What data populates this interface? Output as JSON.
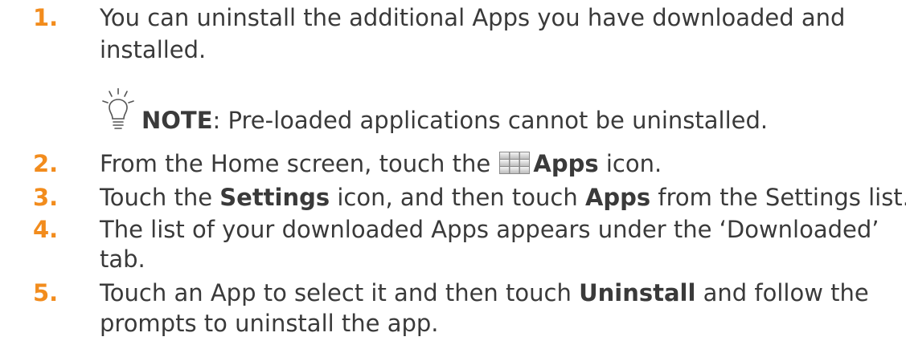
{
  "colors": {
    "number": "#f28c1d",
    "text": "#3a3a3a"
  },
  "steps": [
    {
      "number": "1.",
      "line1": "You can uninstall the additional Apps you have downloaded and",
      "line2": "installed."
    },
    {
      "number": "2.",
      "pre": "From the Home screen, touch the",
      "bold": "Apps",
      "post": "icon.",
      "icon": "apps-grid-icon"
    },
    {
      "number": "3.",
      "pre": "Touch the",
      "bold1": "Settings",
      "mid": "icon, and then touch",
      "bold2": "Apps",
      "post": "from the Settings list."
    },
    {
      "number": "4.",
      "line1": "The list of your downloaded Apps appears under the ‘Downloaded’",
      "line2": "tab."
    },
    {
      "number": "5.",
      "pre": "Touch an App to select it and then touch",
      "bold": "Uninstall",
      "post": "and follow the",
      "line2": "prompts to uninstall the app."
    }
  ],
  "note": {
    "icon": "lightbulb-icon",
    "label": "NOTE",
    "text": ": Pre-loaded applications cannot be uninstalled."
  }
}
